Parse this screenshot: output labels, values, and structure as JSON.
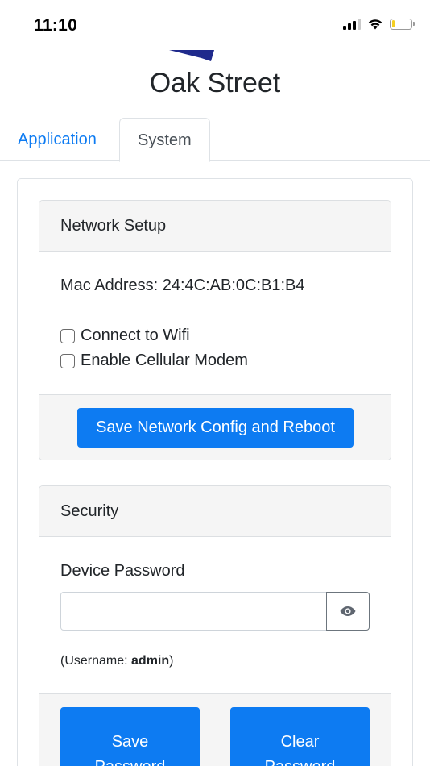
{
  "status_bar": {
    "time": "11:10",
    "battery_level": 0.15,
    "battery_color": "#f5cf20"
  },
  "header": {
    "title": "Oak Street",
    "logo_color": "#1f2a8c"
  },
  "tabs": [
    {
      "label": "Application",
      "active": false
    },
    {
      "label": "System",
      "active": true
    }
  ],
  "network_setup": {
    "header": "Network Setup",
    "mac_label": "Mac Address:",
    "mac_value": "24:4C:AB:0C:B1:B4",
    "options": [
      {
        "label": "Connect to Wifi",
        "checked": false
      },
      {
        "label": "Enable Cellular Modem",
        "checked": false
      }
    ],
    "save_button": "Save Network Config and Reboot"
  },
  "security": {
    "header": "Security",
    "password_label": "Device Password",
    "password_value": "",
    "show_password_icon": "eye-icon",
    "username_prefix": "(Username: ",
    "username_value": "admin",
    "username_suffix": ")",
    "save_button_line1": "Save",
    "save_button_line2": "Password",
    "clear_button_line1": "Clear",
    "clear_button_line2": "Password"
  },
  "colors": {
    "primary": "#0d7bf2",
    "link": "#0d7bf2",
    "card_header_bg": "#f5f5f5"
  }
}
